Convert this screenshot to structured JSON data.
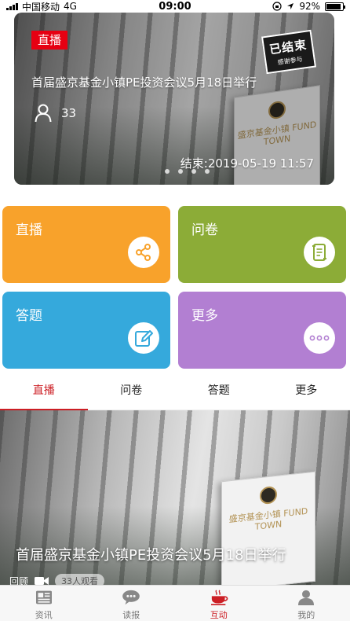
{
  "status_bar": {
    "carrier": "中国移动",
    "network": "4G",
    "time": "09:00",
    "battery": "92%",
    "battery_level": 0.92
  },
  "banner": {
    "badge": "直播",
    "stamp_main": "已结束",
    "stamp_sub": "感谢参与",
    "title": "首届盛京基金小镇PE投资会议5月18日举行",
    "viewers": "33",
    "end_time": "结束:2019-05-19 11:57",
    "sign_text": "盛京基金小镇 FUND TOWN",
    "dot_count": 4
  },
  "tiles": [
    {
      "label": "直播",
      "icon": "share-icon",
      "color": "#f8a22b"
    },
    {
      "label": "问卷",
      "icon": "scroll-icon",
      "color": "#8cac37"
    },
    {
      "label": "答题",
      "icon": "edit-icon",
      "color": "#35a9dc"
    },
    {
      "label": "更多",
      "icon": "more-dots-icon",
      "color": "#b27fd2"
    }
  ],
  "tabs": [
    "直播",
    "问卷",
    "答题",
    "更多"
  ],
  "active_tab": 0,
  "feed": {
    "title": "首届盛京基金小镇PE投资会议5月18日举行",
    "replay": "回顾",
    "views": "33人观看"
  },
  "bottom_nav": [
    {
      "label": "资讯",
      "icon": "news-icon"
    },
    {
      "label": "读报",
      "icon": "chat-icon"
    },
    {
      "label": "互动",
      "icon": "coffee-cup-icon"
    },
    {
      "label": "我的",
      "icon": "user-icon"
    }
  ],
  "active_nav": 2,
  "colors": {
    "accent": "#cc1e24",
    "badge_red": "#e60012"
  }
}
